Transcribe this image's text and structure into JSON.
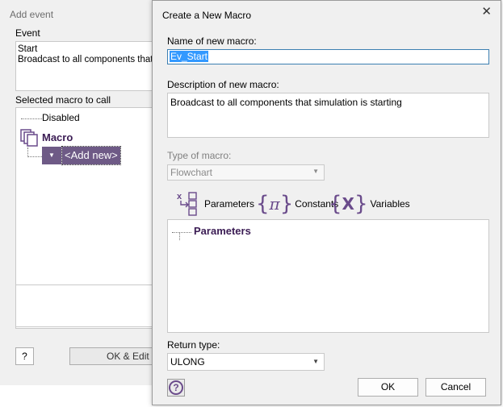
{
  "background_dialog": {
    "title": "Add event",
    "event_label": "Event",
    "event_lines": [
      "Start",
      "Broadcast to all components that si"
    ],
    "selected_macro_label": "Selected macro to call",
    "tree": {
      "disabled": "Disabled",
      "macro": "Macro",
      "add_new": "<Add new>"
    },
    "help_button": "?",
    "ok_edit_button": "OK & Edit M"
  },
  "dialog": {
    "title": "Create a New Macro",
    "close_glyph": "✕",
    "name_label": "Name of new macro:",
    "name_value": "Ev_Start",
    "description_label": "Description of new macro:",
    "description_value": "Broadcast to all components that simulation is starting",
    "type_label": "Type of macro:",
    "type_value": "Flowchart",
    "tabs": [
      {
        "label": "Parameters",
        "icon": "parameters-icon"
      },
      {
        "label": "Constants",
        "icon": "constants-icon",
        "glyph": "π"
      },
      {
        "label": "Variables",
        "icon": "variables-icon",
        "glyph": "X"
      }
    ],
    "parameters_panel_title": "Parameters",
    "return_type_label": "Return type:",
    "return_type_value": "ULONG",
    "help_glyph": "?",
    "ok_button": "OK",
    "cancel_button": "Cancel"
  },
  "colors": {
    "accent_purple": "#6a4b8b",
    "tree_highlight": "#6e5a86",
    "selection_blue": "#3399ff",
    "dialog_bg": "#f0f0f0"
  }
}
